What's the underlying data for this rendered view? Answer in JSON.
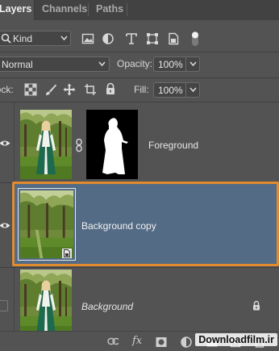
{
  "tabs": [
    {
      "label": "Layers",
      "active": true
    },
    {
      "label": "Channels",
      "active": false
    },
    {
      "label": "Paths",
      "active": false
    }
  ],
  "filter": {
    "kind_value": "Kind",
    "icons": [
      "search-icon",
      "image-filter-icon",
      "adjustment-filter-icon",
      "type-filter-icon",
      "shape-filter-icon",
      "smart-object-filter-icon",
      "filter-toggle-icon"
    ]
  },
  "blend": {
    "mode_value": "Normal",
    "opacity_label": "Opacity:",
    "opacity_value": "100%"
  },
  "lock": {
    "label": "Lock:",
    "fill_label": "Fill:",
    "fill_value": "100%",
    "icons": [
      "lock-transparent-icon",
      "lock-image-icon",
      "lock-position-icon",
      "lock-artboard-icon",
      "lock-all-icon"
    ]
  },
  "layers": [
    {
      "name": "Foreground",
      "visible": true,
      "has_mask": true,
      "selected": false
    },
    {
      "name": "Background copy",
      "visible": true,
      "has_mask": false,
      "selected": true
    },
    {
      "name": "Background",
      "visible": false,
      "locked": true,
      "selected": false
    }
  ],
  "bottom_icons": [
    "link-icon",
    "fx-icon",
    "mask-icon",
    "adjustment-icon",
    "group-icon",
    "new-layer-icon",
    "trash-icon"
  ],
  "fx_label": "fx",
  "watermark": "Downloadfilm.ir",
  "colors": {
    "panel_bg": "#535353",
    "tab_bg": "#424242",
    "selected_row": "#536b85",
    "highlight_border": "#e28a2e"
  }
}
